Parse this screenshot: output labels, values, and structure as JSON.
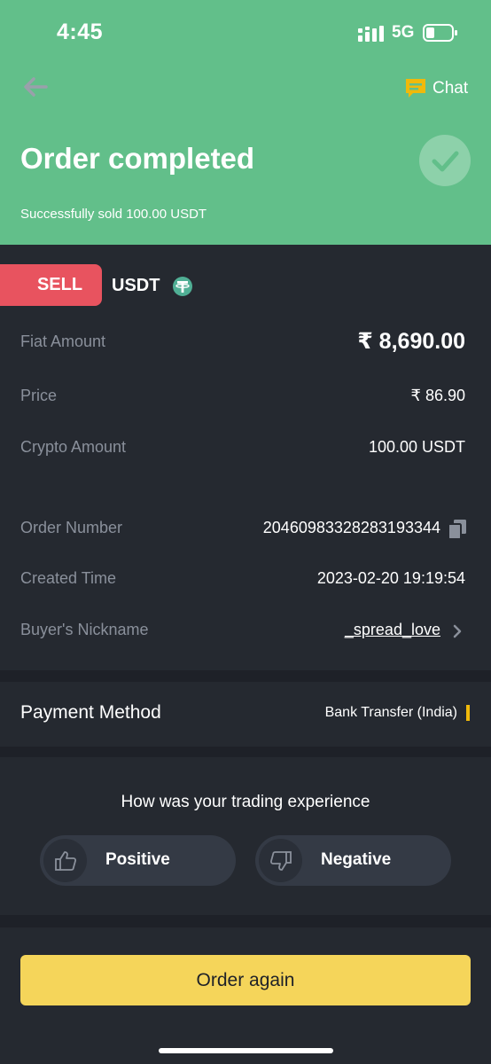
{
  "status_bar": {
    "time": "4:45",
    "network": "5G",
    "icons": [
      "signal-icon",
      "battery-icon"
    ]
  },
  "header": {
    "back_icon": "arrow-left-icon",
    "chat_label": "Chat",
    "chat_icon": "chat-icon",
    "title": "Order completed",
    "subtitle": "Successfully sold 100.00 USDT",
    "status_icon": "check-icon",
    "background_color": "#62bf8a"
  },
  "order": {
    "side": "SELL",
    "side_color": "#e8535f",
    "asset": "USDT",
    "asset_icon": "tether-icon",
    "rows": {
      "fiat_amount": {
        "label": "Fiat Amount",
        "value": "₹ 8,690.00"
      },
      "price": {
        "label": "Price",
        "value": "₹ 86.90"
      },
      "crypto_amount": {
        "label": "Crypto Amount",
        "value": "100.00 USDT"
      },
      "order_number": {
        "label": "Order Number",
        "value": "20460983328283193344"
      },
      "created_time": {
        "label": "Created Time",
        "value": "2023-02-20 19:19:54"
      },
      "buyer_nickname": {
        "label": "Buyer's Nickname",
        "value": "_spread_love"
      }
    }
  },
  "payment": {
    "label": "Payment Method",
    "value": "Bank Transfer (India)",
    "accent_color": "#f0b90b"
  },
  "feedback": {
    "question": "How was your trading experience",
    "positive_label": "Positive",
    "negative_label": "Negative"
  },
  "actions": {
    "order_again_label": "Order again",
    "button_color": "#f5d55a"
  }
}
